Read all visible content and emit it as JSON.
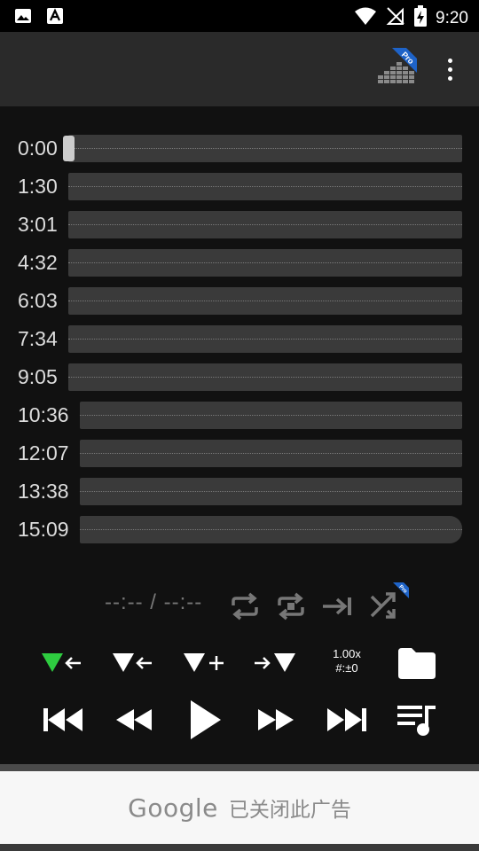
{
  "status_bar": {
    "time": "9:20",
    "left_icons": [
      "image-icon",
      "text-icon"
    ],
    "right_icons": [
      "wifi-icon",
      "signal-off-icon",
      "battery-charging-icon"
    ]
  },
  "app_bar": {
    "logo_badge": "Pro",
    "menu_icon": "more-vert-icon"
  },
  "timeline": {
    "markers": [
      "0:00",
      "1:30",
      "3:01",
      "4:32",
      "6:03",
      "7:34",
      "9:05",
      "10:36",
      "12:07",
      "13:38",
      "15:09"
    ]
  },
  "controls": {
    "time_display": "--:-- / --:--",
    "row1_icons": [
      "repeat-icon",
      "repeat-one-icon",
      "skip-to-end-icon",
      "shuffle-pro-icon"
    ],
    "shuffle_badge": "Pro",
    "marker_buttons": [
      "marker-left-icon",
      "marker-prev-icon",
      "marker-add-icon",
      "marker-right-icon"
    ],
    "speed_value": "1.00x",
    "pitch_value": "#:±0",
    "folder_icon": "folder-icon",
    "transport": [
      "skip-previous-icon",
      "rewind-icon",
      "play-icon",
      "fast-forward-icon",
      "skip-next-icon",
      "playlist-icon"
    ]
  },
  "ad": {
    "brand": "Google",
    "text": "已关闭此广告"
  },
  "colors": {
    "accent_green": "#2ecc40",
    "pro_badge_blue": "#1e63c8",
    "bar_fill": "#3a3a3a",
    "background": "#111111",
    "app_bar": "#2a2a2a"
  }
}
